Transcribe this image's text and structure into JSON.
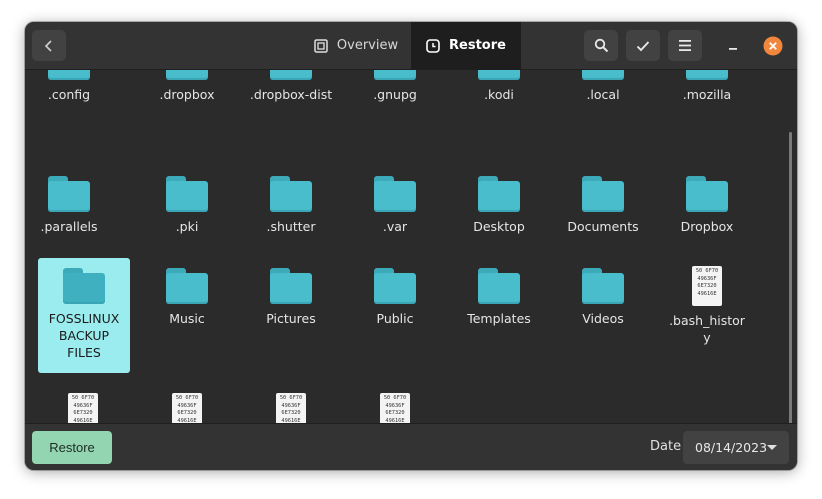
{
  "header": {
    "tabs": [
      {
        "label": "Overview",
        "icon": "overview-icon",
        "active": false
      },
      {
        "label": "Restore",
        "icon": "restore-clock-icon",
        "active": true
      }
    ]
  },
  "files": {
    "row1": [
      ".config",
      ".dropbox",
      ".dropbox-dist",
      ".gnupg",
      ".kodi",
      ".local",
      ".mozilla"
    ],
    "row2": [
      ".parallels",
      ".pki",
      ".shutter",
      ".var",
      "Desktop",
      "Documents",
      "Dropbox"
    ],
    "row3": [
      "FOSSLINUX BACKUP FILES",
      "Music",
      "Pictures",
      "Public",
      "Templates",
      "Videos",
      ".bash_history"
    ],
    "row4": [
      "",
      "",
      "",
      ""
    ]
  },
  "text_icon_lines": [
    "50 6F70",
    "49636F",
    "6E7320",
    "49616E"
  ],
  "footer": {
    "restore_label": "Restore",
    "date_label": "Date",
    "date_value": "08/14/2023"
  },
  "colors": {
    "accent_button": "#94d5b1",
    "selection": "#9aecee",
    "folder": "#49bdcc",
    "close": "#f0873c"
  }
}
